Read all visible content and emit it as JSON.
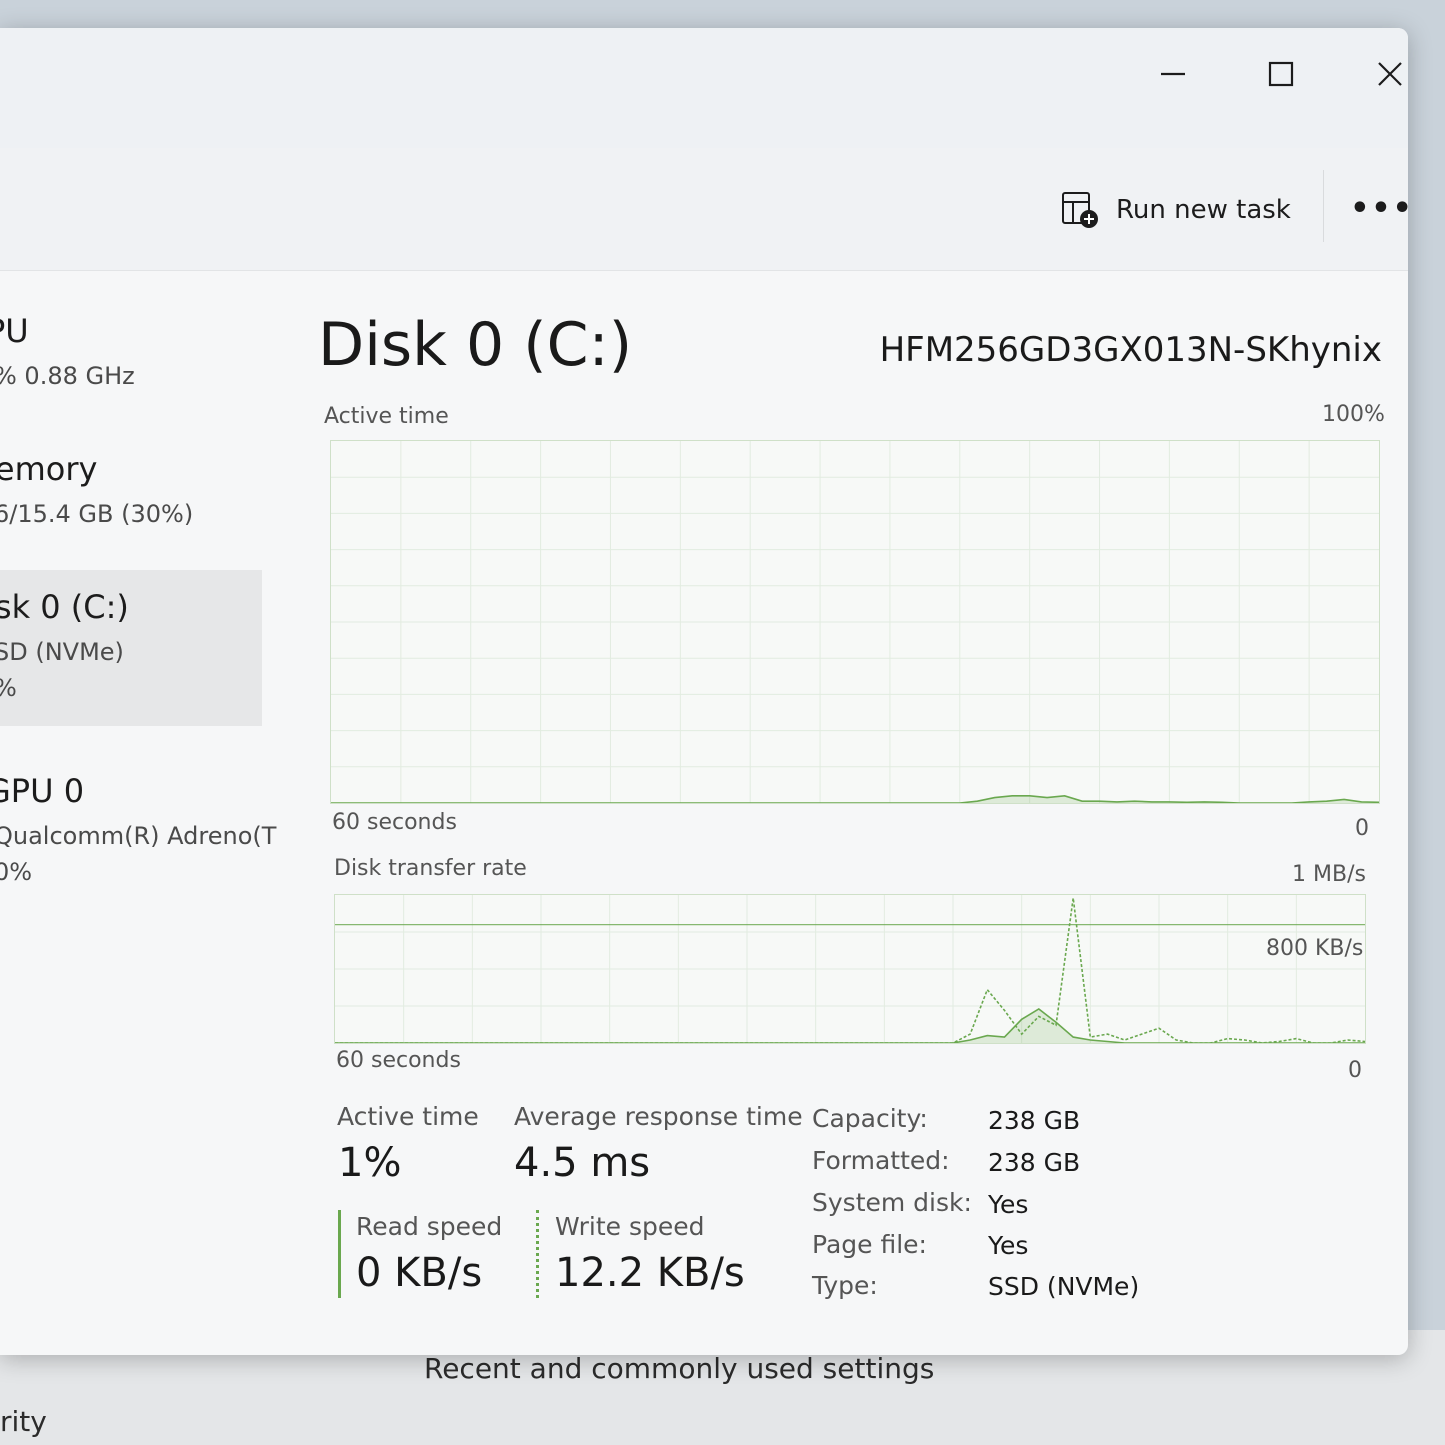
{
  "window_controls": {
    "minimize_icon": "minimize-icon",
    "maximize_icon": "maximize-icon",
    "close_icon": "close-icon"
  },
  "command_bar": {
    "run_new_task_label": "Run new task",
    "run_new_task_icon": "run-task-icon",
    "more_label": "•••"
  },
  "sidebar": {
    "items": [
      {
        "title": "PU",
        "sub": [
          "% 0.88 GHz"
        ]
      },
      {
        "title": "lemory",
        "sub": [
          "6/15.4 GB (30%)"
        ]
      },
      {
        "title": "isk 0 (C:)",
        "sub": [
          "SD (NVMe)",
          "%"
        ],
        "selected": true
      },
      {
        "title": "GPU 0",
        "sub": [
          "Qualcomm(R) Adreno(T",
          "0%"
        ]
      }
    ]
  },
  "main": {
    "title": "Disk 0 (C:)",
    "model": "HFM256GD3GX013N-SKhynix"
  },
  "chart_data": [
    {
      "type": "line",
      "title": "Active time",
      "ymax_label": "100%",
      "xlabel": "60 seconds",
      "ymin_label": "0",
      "ylim": [
        0,
        100
      ],
      "x": [
        0,
        1,
        2,
        3,
        4,
        5,
        6,
        7,
        8,
        9,
        10,
        11,
        12,
        13,
        14,
        15,
        16,
        17,
        18,
        19,
        20,
        21,
        22,
        23,
        24,
        25,
        26,
        27,
        28,
        29,
        30,
        31,
        32,
        33,
        34,
        35,
        36,
        37,
        38,
        39,
        40,
        41,
        42,
        43,
        44,
        45,
        46,
        47,
        48,
        49,
        50,
        51,
        52,
        53,
        54,
        55,
        56,
        57,
        58,
        59,
        60
      ],
      "series": [
        {
          "values": [
            0,
            0,
            0,
            0,
            0,
            0,
            0,
            0,
            0,
            0,
            0,
            0,
            0,
            0,
            0,
            0,
            0,
            0,
            0,
            0,
            0,
            0,
            0,
            0,
            0,
            0,
            0,
            0,
            0,
            0,
            0,
            0,
            0,
            0,
            0,
            0,
            0,
            0.5,
            1.5,
            2,
            2,
            1.5,
            2,
            0.5,
            0.5,
            0.3,
            0.5,
            0.3,
            0.3,
            0.2,
            0.3,
            0.2,
            0,
            0,
            0,
            0,
            0.3,
            0.5,
            1,
            0.3,
            0.2
          ]
        }
      ]
    },
    {
      "type": "line",
      "title": "Disk transfer rate",
      "ymax_label": "1 MB/s",
      "ref_label": "800 KB/s",
      "ref_value": 800,
      "xlabel": "60 seconds",
      "ymin_label": "0",
      "ylim": [
        0,
        1000
      ],
      "x": [
        0,
        1,
        2,
        3,
        4,
        5,
        6,
        7,
        8,
        9,
        10,
        11,
        12,
        13,
        14,
        15,
        16,
        17,
        18,
        19,
        20,
        21,
        22,
        23,
        24,
        25,
        26,
        27,
        28,
        29,
        30,
        31,
        32,
        33,
        34,
        35,
        36,
        37,
        38,
        39,
        40,
        41,
        42,
        43,
        44,
        45,
        46,
        47,
        48,
        49,
        50,
        51,
        52,
        53,
        54,
        55,
        56,
        57,
        58,
        59,
        60
      ],
      "series": [
        {
          "name": "Read speed",
          "style": "solid",
          "values": [
            0,
            0,
            0,
            0,
            0,
            0,
            0,
            0,
            0,
            0,
            0,
            0,
            0,
            0,
            0,
            0,
            0,
            0,
            0,
            0,
            0,
            0,
            0,
            0,
            0,
            0,
            0,
            0,
            0,
            0,
            0,
            0,
            0,
            0,
            0,
            0,
            0,
            20,
            50,
            40,
            160,
            230,
            140,
            40,
            20,
            10,
            0,
            0,
            0,
            0,
            0,
            0,
            0,
            0,
            0,
            0,
            0,
            0,
            0,
            0,
            0
          ]
        },
        {
          "name": "Write speed",
          "style": "dotted",
          "values": [
            0,
            0,
            0,
            0,
            0,
            0,
            0,
            0,
            0,
            0,
            0,
            0,
            0,
            0,
            0,
            0,
            0,
            0,
            0,
            0,
            0,
            0,
            0,
            0,
            0,
            0,
            0,
            0,
            0,
            0,
            0,
            0,
            0,
            0,
            0,
            0,
            0,
            60,
            360,
            220,
            60,
            180,
            120,
            980,
            40,
            60,
            20,
            60,
            100,
            20,
            0,
            0,
            30,
            20,
            0,
            10,
            30,
            0,
            0,
            20,
            10
          ]
        }
      ]
    }
  ],
  "stats": {
    "active_time_label": "Active time",
    "active_time_value": "1%",
    "avg_response_label": "Average response time",
    "avg_response_value": "4.5 ms",
    "read_speed_label": "Read speed",
    "read_speed_value": "0 KB/s",
    "write_speed_label": "Write speed",
    "write_speed_value": "12.2 KB/s"
  },
  "properties": [
    {
      "label": "Capacity:",
      "value": "238 GB"
    },
    {
      "label": "Formatted:",
      "value": "238 GB"
    },
    {
      "label": "System disk:",
      "value": "Yes"
    },
    {
      "label": "Page file:",
      "value": "Yes"
    },
    {
      "label": "Type:",
      "value": "SSD (NVMe)"
    }
  ],
  "background": {
    "settings_heading": "Recent and commonly used settings",
    "sidebar_fragment": "rity"
  },
  "colors": {
    "accent_green": "#6aa84f",
    "grid": "#e2ece0"
  }
}
